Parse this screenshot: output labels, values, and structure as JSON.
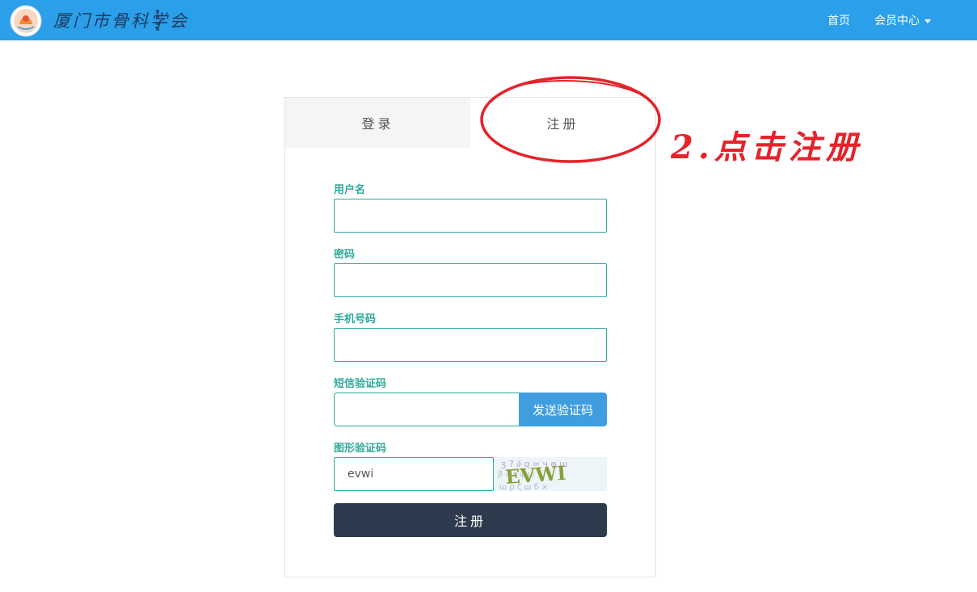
{
  "header": {
    "brand": "厦门市骨科学会",
    "nav": {
      "home": "首页",
      "member_center": "会员中心"
    }
  },
  "tabs": {
    "login": "登录",
    "register": "注册"
  },
  "form": {
    "username_label": "用户名",
    "password_label": "密码",
    "phone_label": "手机号码",
    "sms_label": "短信验证码",
    "sms_button": "发送验证码",
    "captcha_label": "图形验证码",
    "captcha_value": "evwi",
    "captcha_image_text": "EVWI",
    "submit": "注册"
  },
  "annotation": {
    "text": "2.点击注册",
    "color": "#e4232b"
  },
  "colors": {
    "navbar": "#2b9fea",
    "accent": "#2ea99a",
    "sms_button": "#3e9edf",
    "submit": "#2e3b4e"
  }
}
